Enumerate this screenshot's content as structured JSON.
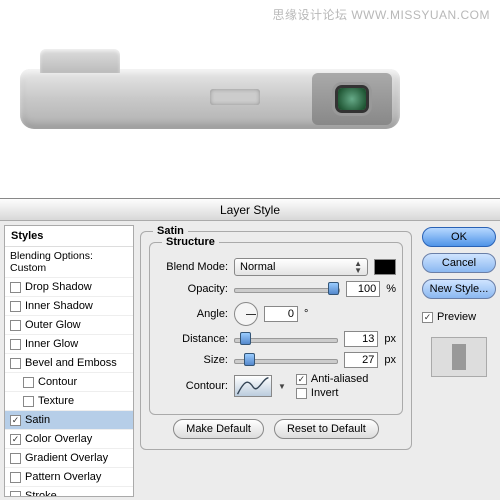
{
  "watermark": "思缘设计论坛  WWW.MISSYUAN.COM",
  "dialog_title": "Layer Style",
  "sidebar": {
    "header": "Styles",
    "blending": "Blending Options: Custom",
    "items": [
      {
        "label": "Drop Shadow",
        "checked": false,
        "indent": false
      },
      {
        "label": "Inner Shadow",
        "checked": false,
        "indent": false
      },
      {
        "label": "Outer Glow",
        "checked": false,
        "indent": false
      },
      {
        "label": "Inner Glow",
        "checked": false,
        "indent": false
      },
      {
        "label": "Bevel and Emboss",
        "checked": false,
        "indent": false
      },
      {
        "label": "Contour",
        "checked": false,
        "indent": true
      },
      {
        "label": "Texture",
        "checked": false,
        "indent": true
      },
      {
        "label": "Satin",
        "checked": true,
        "indent": false,
        "selected": true
      },
      {
        "label": "Color Overlay",
        "checked": true,
        "indent": false
      },
      {
        "label": "Gradient Overlay",
        "checked": false,
        "indent": false
      },
      {
        "label": "Pattern Overlay",
        "checked": false,
        "indent": false
      },
      {
        "label": "Stroke",
        "checked": false,
        "indent": false
      }
    ]
  },
  "panel": {
    "title": "Satin",
    "structure": "Structure",
    "blend_mode_label": "Blend Mode:",
    "blend_mode_value": "Normal",
    "opacity_label": "Opacity:",
    "opacity_value": "100",
    "opacity_unit": "%",
    "angle_label": "Angle:",
    "angle_value": "0",
    "angle_unit": "°",
    "distance_label": "Distance:",
    "distance_value": "13",
    "size_label": "Size:",
    "size_value": "27",
    "px": "px",
    "contour_label": "Contour:",
    "antialiased": "Anti-aliased",
    "invert": "Invert",
    "make_default": "Make Default",
    "reset_default": "Reset to Default"
  },
  "buttons": {
    "ok": "OK",
    "cancel": "Cancel",
    "new_style": "New Style...",
    "preview": "Preview"
  }
}
